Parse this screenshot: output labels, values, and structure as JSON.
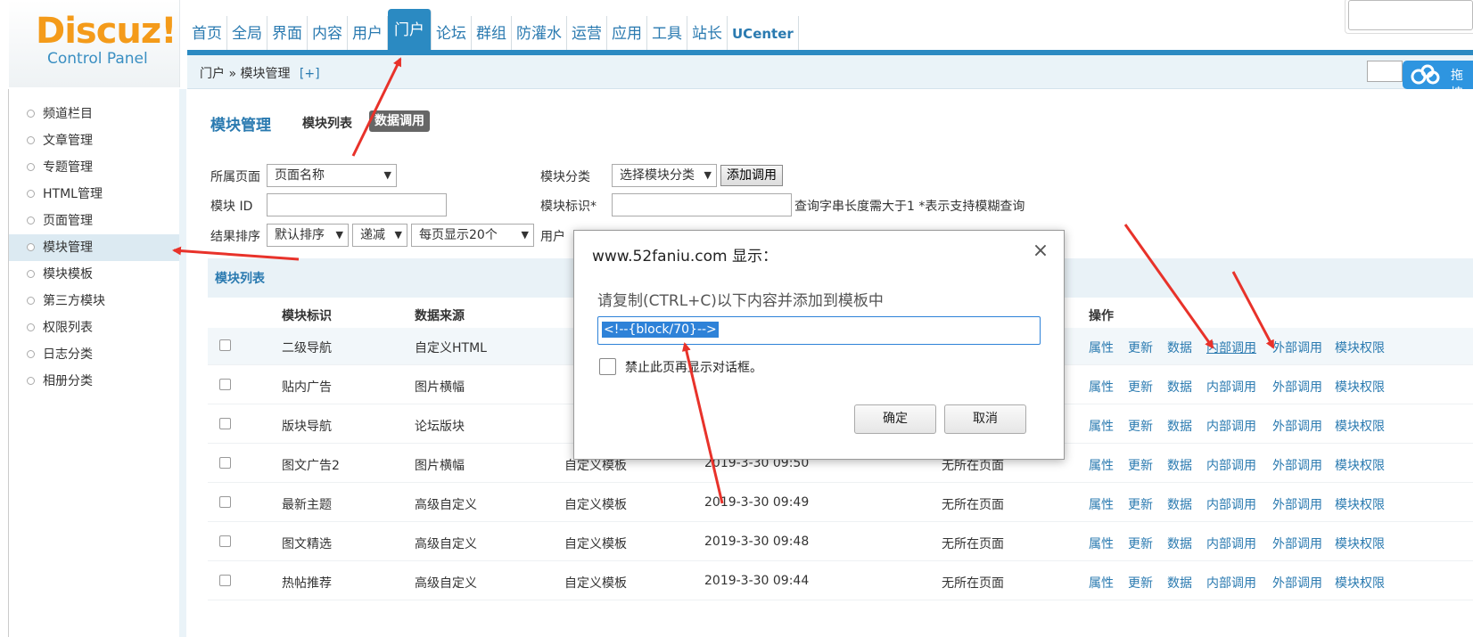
{
  "header": {
    "logo": "Discuz!",
    "logo_sub": "Control Panel",
    "nav": [
      "首页",
      "全局",
      "界面",
      "内容",
      "用户",
      "门户",
      "论坛",
      "群组",
      "防灌水",
      "运营",
      "应用",
      "工具",
      "站长",
      "UCenter"
    ],
    "active_nav": "门户",
    "cloud_button": "拖拽"
  },
  "breadcrumb": {
    "path": "门户 » 模块管理",
    "plus": "[+]"
  },
  "sidebar": {
    "items": [
      "频道栏目",
      "文章管理",
      "专题管理",
      "HTML管理",
      "页面管理",
      "模块管理",
      "模块模板",
      "第三方模块",
      "权限列表",
      "日志分类",
      "相册分类"
    ],
    "active": "模块管理"
  },
  "main": {
    "title": "模块管理",
    "tab_list": "模块列表",
    "tab_call": "数据调用"
  },
  "filters": {
    "page_label": "所属页面",
    "page_value": "页面名称",
    "category_label": "模块分类",
    "category_value": "选择模块分类",
    "add_button": "添加调用",
    "id_label": "模块 ID",
    "mark_label": "模块标识*",
    "hint": "查询字串长度需大于1  *表示支持模糊查询",
    "sort_label": "结果排序",
    "sort_value": "默认排序",
    "order_value": "递减",
    "per_page_value": "每页显示20个",
    "user_label": "用户"
  },
  "table": {
    "section_title": "模块列表",
    "headers": [
      "模块标识",
      "数据来源",
      "操作"
    ],
    "rows": [
      {
        "name": "二级导航",
        "source": "自定义HTML",
        "template": "",
        "time": "",
        "page": ""
      },
      {
        "name": "贴内广告",
        "source": "图片横幅",
        "template": "",
        "time": "",
        "page": ""
      },
      {
        "name": "版块导航",
        "source": "论坛版块",
        "template": "",
        "time": "",
        "page": ""
      },
      {
        "name": "图文广告2",
        "source": "图片横幅",
        "template": "自定义模板",
        "time": "2019-3-30 09:50",
        "page": "无所在页面"
      },
      {
        "name": "最新主题",
        "source": "高级自定义",
        "template": "自定义模板",
        "time": "2019-3-30 09:49",
        "page": "无所在页面"
      },
      {
        "name": "图文精选",
        "source": "高级自定义",
        "template": "自定义模板",
        "time": "2019-3-30 09:48",
        "page": "无所在页面"
      },
      {
        "name": "热帖推荐",
        "source": "高级自定义",
        "template": "自定义模板",
        "time": "2019-3-30 09:44",
        "page": "无所在页面"
      }
    ],
    "ops": [
      "属性",
      "更新",
      "数据",
      "内部调用",
      "外部调用",
      "模块权限"
    ]
  },
  "dialog": {
    "title": "www.52faniu.com 显示：",
    "message": "请复制(CTRL+C)以下内容并添加到模板中",
    "code": "<!--{block/70}-->",
    "checkbox_label": "禁止此页再显示对话框。",
    "ok": "确定",
    "cancel": "取消"
  },
  "colors": {
    "accent": "#2b8ac2",
    "logo": "#f49b1a",
    "annotation_arrow": "#e8322a"
  }
}
